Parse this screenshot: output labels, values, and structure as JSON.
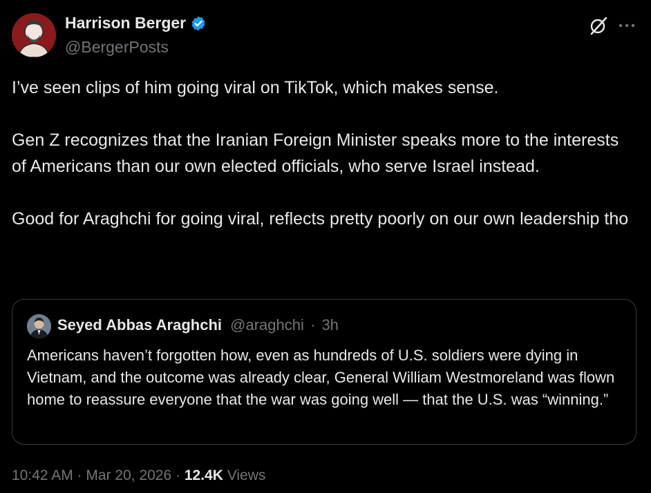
{
  "author": {
    "name": "Harrison Berger",
    "handle": "@BergerPosts",
    "verified_icon": "verified-badge-icon",
    "verified_color": "#1d9bf0"
  },
  "header_icons": [
    "grok-icon",
    "more-icon"
  ],
  "tweet": {
    "paragraphs": [
      "I’ve seen clips of him going viral on TikTok, which makes sense.",
      "Gen Z recognizes that the Iranian Foreign Minister speaks more to the interests of Americans than our own elected officials, who serve Israel instead.",
      "Good for Araghchi for going viral, reflects pretty poorly on our own leadership tho"
    ]
  },
  "quote": {
    "name": "Seyed Abbas Araghchi",
    "handle": "@araghchi",
    "separator": "·",
    "time": "3h",
    "text": "Americans haven’t forgotten how, even as hundreds of U.S. soldiers were dying in Vietnam, and the outcome was already clear, General William Westmoreland was flown home to reassure everyone that the war was going well — that the U.S. was “winning.”"
  },
  "footer": {
    "time": "10:42 AM",
    "sep1": "·",
    "date": "Mar 20, 2026",
    "sep2": "·",
    "views_count": "12.4K",
    "views_label": "Views"
  },
  "colors": {
    "background": "#000000",
    "text": "#e7e9ea",
    "secondary": "#71767b",
    "border": "#3a3d41"
  }
}
